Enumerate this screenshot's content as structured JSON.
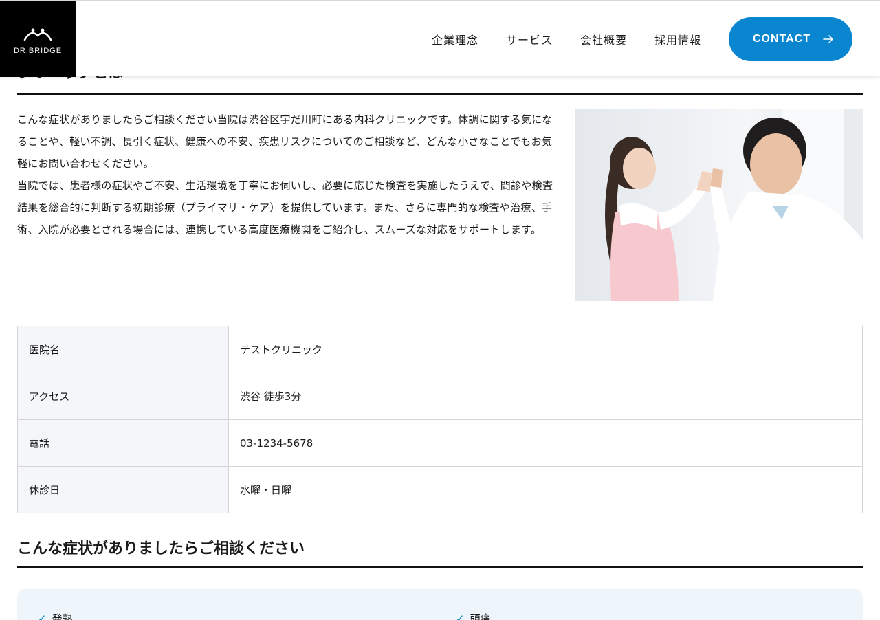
{
  "header": {
    "logo_text": "DR.BRIDGE",
    "nav": [
      "企業理念",
      "サービス",
      "会社概要",
      "採用情報"
    ],
    "contact_label": "CONTACT",
    "accent_color": "#0a86d0"
  },
  "intro_section": {
    "heading_partial": "クリニックとは",
    "paragraphs": [
      "こんな症状がありましたらご相談ください当院は渋谷区宇だ川町にある内科クリニックです。体調に関する気になることや、軽い不調、長引く症状、健康への不安、疾患リスクについてのご相談など、どんな小さなことでもお気軽にお問い合わせください。",
      "当院では、患者様の症状やご不安、生活環境を丁寧にお伺いし、必要に応じた検査を実施したうえで、問診や検査結果を総合的に判断する初期診療（プライマリ・ケア）を提供しています。また、さらに専門的な検査や治療、手術、入院が必要とされる場合には、連携している高度医療機関をご紹介し、スムーズな対応をサポートします。"
    ]
  },
  "info_table": [
    {
      "label": "医院名",
      "value": "テストクリニック"
    },
    {
      "label": "アクセス",
      "value": "渋谷 徒歩3分"
    },
    {
      "label": "電話",
      "value": "03-1234-5678"
    },
    {
      "label": "休診日",
      "value": "水曜・日曜"
    }
  ],
  "symptoms_section": {
    "title": "こんな症状がありましたらご相談ください",
    "items": [
      "発熱",
      "頭痛"
    ]
  }
}
